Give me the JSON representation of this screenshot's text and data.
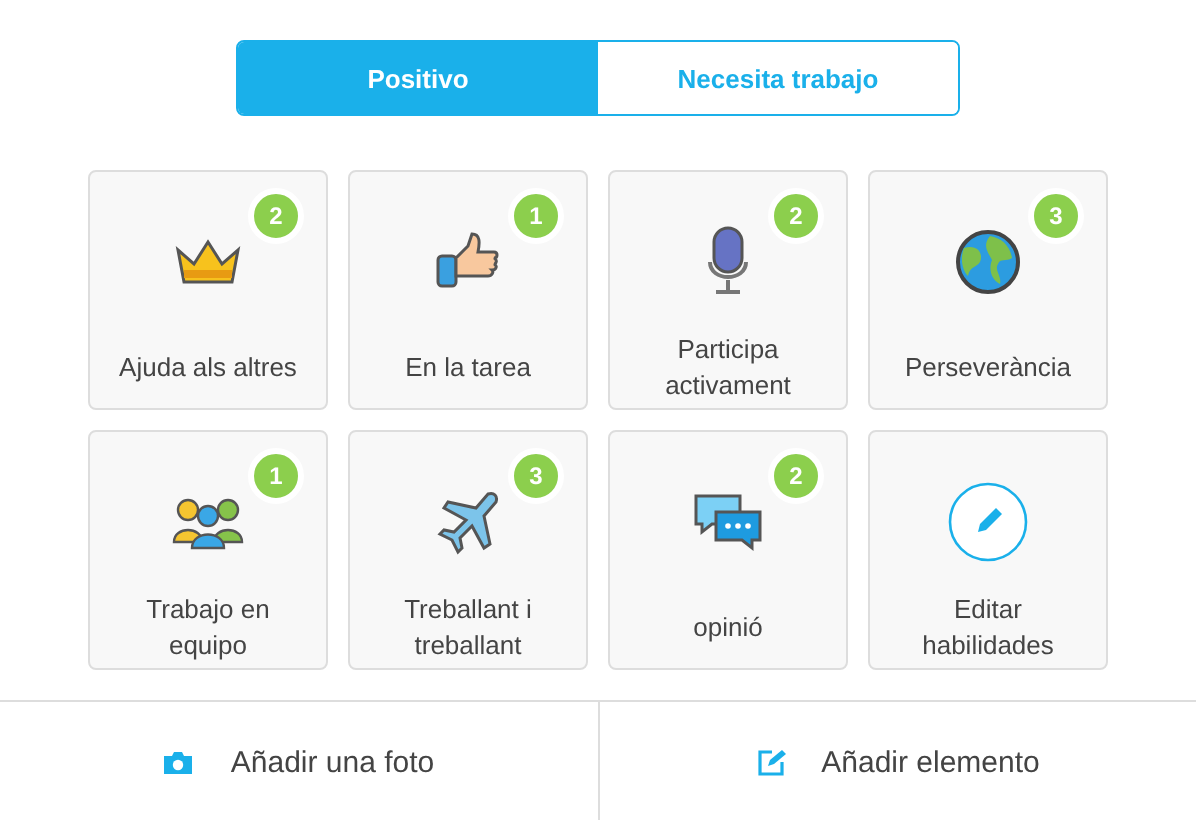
{
  "tabs": [
    {
      "label": "Positivo",
      "selected": true
    },
    {
      "label": "Necesita trabajo",
      "selected": false
    }
  ],
  "skills": [
    {
      "kind": "skill",
      "label": "Ajuda als altres",
      "count": "2"
    },
    {
      "kind": "skill",
      "label": "En la tarea",
      "count": "1"
    },
    {
      "kind": "skill",
      "label": "Participa activament",
      "count": "2"
    },
    {
      "kind": "skill",
      "label": "Perseverància",
      "count": "3"
    },
    {
      "kind": "skill",
      "label": "Trabajo en equipo",
      "count": "1"
    },
    {
      "kind": "skill",
      "label": "Treballant i treballant",
      "count": "3"
    },
    {
      "kind": "skill",
      "label": "opinió",
      "count": "2"
    },
    {
      "kind": "edit",
      "label": "Editar habilidades"
    }
  ],
  "footer": [
    {
      "label": "Añadir una foto"
    },
    {
      "label": "Añadir elemento"
    }
  ]
}
